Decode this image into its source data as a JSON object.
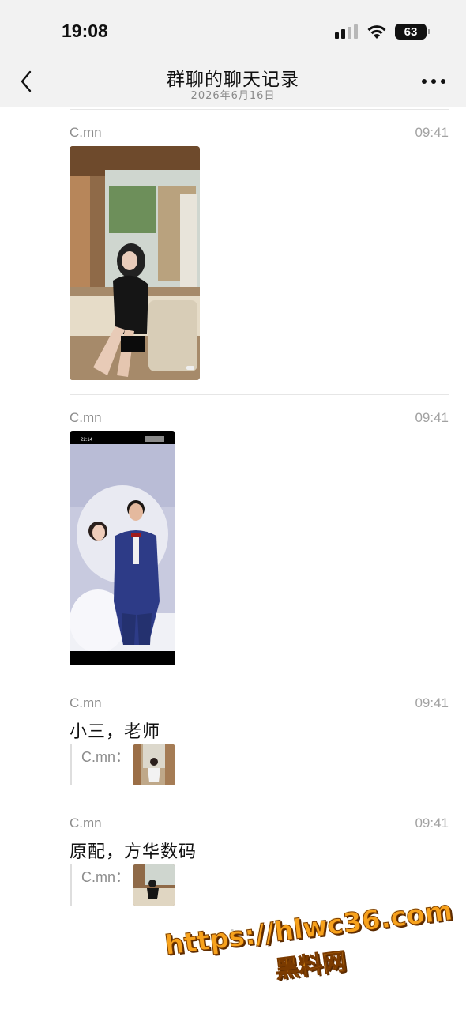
{
  "status_bar": {
    "time": "19:08",
    "battery_level": "63",
    "icons": [
      "cellular-signal-icon",
      "wifi-icon",
      "battery-icon"
    ]
  },
  "nav": {
    "title": "群聊的聊天记录",
    "subtitle": "2026年6月16日",
    "icons": [
      "back-chevron-icon",
      "more-ellipsis-icon"
    ]
  },
  "messages": [
    {
      "sender": "C.mn",
      "time": "09:41",
      "type": "image",
      "image_desc": "woman in black dress sitting on sofa"
    },
    {
      "sender": "C.mn",
      "time": "09:41",
      "type": "image",
      "image_desc": "phone screenshot of wedding photo"
    },
    {
      "sender": "C.mn",
      "time": "09:41",
      "type": "text",
      "text": "小三，老师",
      "quote": {
        "label": "C.mn：",
        "type": "image"
      }
    },
    {
      "sender": "C.mn",
      "time": "09:41",
      "type": "text",
      "text": "原配，方华数码",
      "quote": {
        "label": "C.mn：",
        "type": "image"
      }
    }
  ],
  "screenshot_status": {
    "time": "22:14"
  },
  "watermark": {
    "url": "https://hlwc36.com",
    "text": "黑料网"
  },
  "colors": {
    "header_bg": "#f2f2f2",
    "meta_text": "#8d8d8d",
    "divider": "#e6e6e6",
    "watermark": "#f7a21c"
  }
}
